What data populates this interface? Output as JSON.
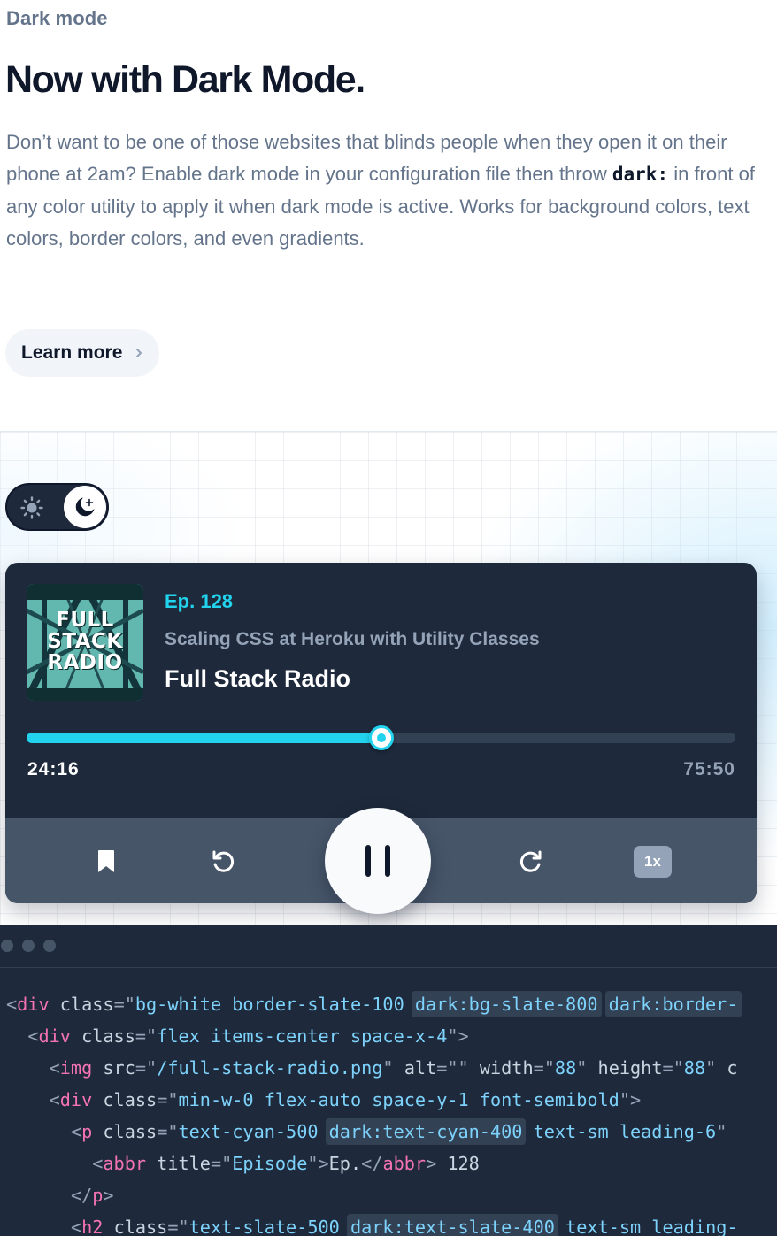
{
  "intro": {
    "eyebrow": "Dark mode",
    "headline": "Now with Dark Mode.",
    "body_before": "Don’t want to be one of those websites that blinds people when they open it on their phone at 2am? Enable dark mode in your configuration file then throw ",
    "body_code": "dark:",
    "body_after": " in front of any color utility to apply it when dark mode is active. Works for background colors, text colors, border colors, and even gradients.",
    "learn_more": "Learn more"
  },
  "theme_toggle": {
    "options": [
      "sun-icon",
      "moon-icon"
    ],
    "selected": "moon-icon"
  },
  "player": {
    "cover_words": [
      "FULL",
      "STACK",
      "RADIO"
    ],
    "episode": "Ep. 128",
    "episode_title": "Scaling CSS at Heroku with Utility Classes",
    "show": "Full Stack Radio",
    "progress": 0.5,
    "current_time": "24:16",
    "total_time": "75:50",
    "speed": "1x",
    "controls": [
      "bookmark-icon",
      "rewind-icon",
      "pause-icon",
      "fast-forward-icon"
    ]
  },
  "colors": {
    "accent": "#22d3ee",
    "card_bg": "#1e293b",
    "controls_bg": "#475569",
    "headline": "#0f172a",
    "muted": "#64748b"
  }
}
